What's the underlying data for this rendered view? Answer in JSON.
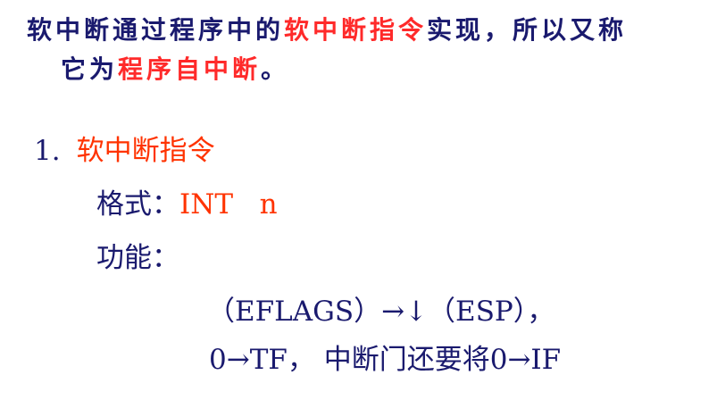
{
  "intro": {
    "line1_a": "软中断通过程序中的",
    "line1_highlight": "软中断指令",
    "line1_b": "实现，所以又称",
    "line2_a": "它为",
    "line2_highlight": "程序自中断",
    "line2_b": "。"
  },
  "section": {
    "number": "1.",
    "title": "软中断指令"
  },
  "format": {
    "label": "格式：",
    "value": "INT   n"
  },
  "function": {
    "label": "功能："
  },
  "ops": {
    "line1": "（EFLAGS）→↓（ESP），",
    "line2": "0→TF， 中断门还要将0→IF"
  },
  "colors": {
    "text": "#1a1a6e",
    "highlight": "#ff2a2a",
    "accent": "#ff3300"
  }
}
